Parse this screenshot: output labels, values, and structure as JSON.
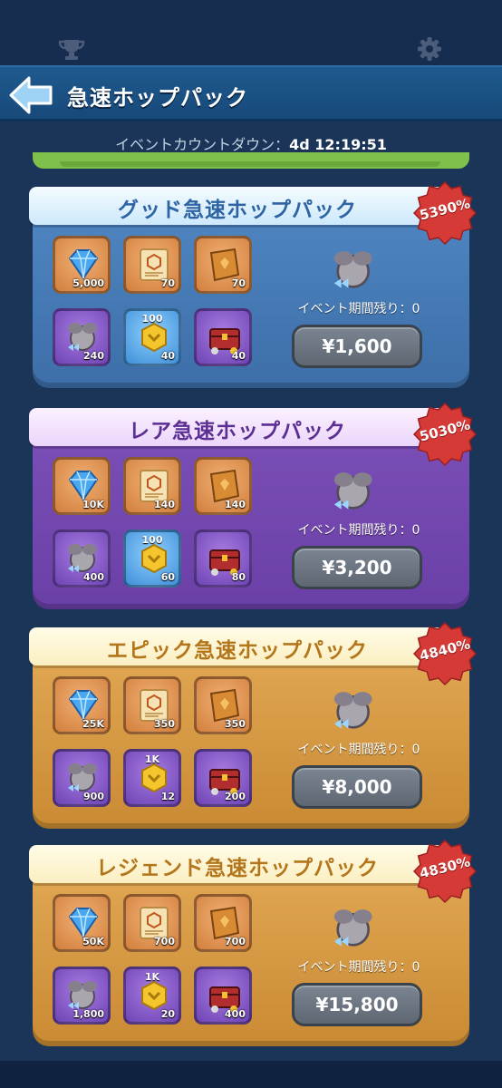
{
  "header": {
    "title": "急速ホップパック"
  },
  "countdown": {
    "label": "イベントカウントダウン：",
    "value": "4d 12:19:51"
  },
  "packs": [
    {
      "name": "グッド急速ホップパック",
      "discount": "5390%",
      "remaining": "イベント期間残り：0",
      "price": "¥1,600",
      "items": [
        {
          "icon": "diamond-icon",
          "qty": "5,000"
        },
        {
          "icon": "scroll-icon",
          "qty": "70"
        },
        {
          "icon": "tome-icon",
          "qty": "70"
        },
        {
          "icon": "ticket-icon",
          "qty": "240"
        },
        {
          "icon": "coin-hex-icon",
          "qty": "40",
          "top": "100"
        },
        {
          "icon": "chest-icon",
          "qty": "40"
        }
      ]
    },
    {
      "name": "レア急速ホップパック",
      "discount": "5030%",
      "remaining": "イベント期間残り：0",
      "price": "¥3,200",
      "items": [
        {
          "icon": "diamond-icon",
          "qty": "10K"
        },
        {
          "icon": "scroll-icon",
          "qty": "140"
        },
        {
          "icon": "tome-icon",
          "qty": "140"
        },
        {
          "icon": "ticket-icon",
          "qty": "400"
        },
        {
          "icon": "coin-hex-icon",
          "qty": "60",
          "top": "100"
        },
        {
          "icon": "chest-icon",
          "qty": "80"
        }
      ]
    },
    {
      "name": "エピック急速ホップパック",
      "discount": "4840%",
      "remaining": "イベント期間残り：0",
      "price": "¥8,000",
      "items": [
        {
          "icon": "diamond-icon",
          "qty": "25K"
        },
        {
          "icon": "scroll-icon",
          "qty": "350"
        },
        {
          "icon": "tome-icon",
          "qty": "350"
        },
        {
          "icon": "ticket-icon",
          "qty": "900"
        },
        {
          "icon": "coin-hex-icon",
          "qty": "12",
          "top": "1K"
        },
        {
          "icon": "chest-icon",
          "qty": "200"
        }
      ]
    },
    {
      "name": "レジェンド急速ホップパック",
      "discount": "4830%",
      "remaining": "イベント期間残り：0",
      "price": "¥15,800",
      "items": [
        {
          "icon": "diamond-icon",
          "qty": "50K"
        },
        {
          "icon": "scroll-icon",
          "qty": "700"
        },
        {
          "icon": "tome-icon",
          "qty": "700"
        },
        {
          "icon": "ticket-icon",
          "qty": "1,800"
        },
        {
          "icon": "coin-hex-icon",
          "qty": "20",
          "top": "1K"
        },
        {
          "icon": "chest-icon",
          "qty": "400"
        }
      ]
    }
  ],
  "colors": {
    "background": "#1a3558",
    "header": "#1f5a8e",
    "discount_badge": "#d63a36",
    "price_button": "#6b7480"
  }
}
